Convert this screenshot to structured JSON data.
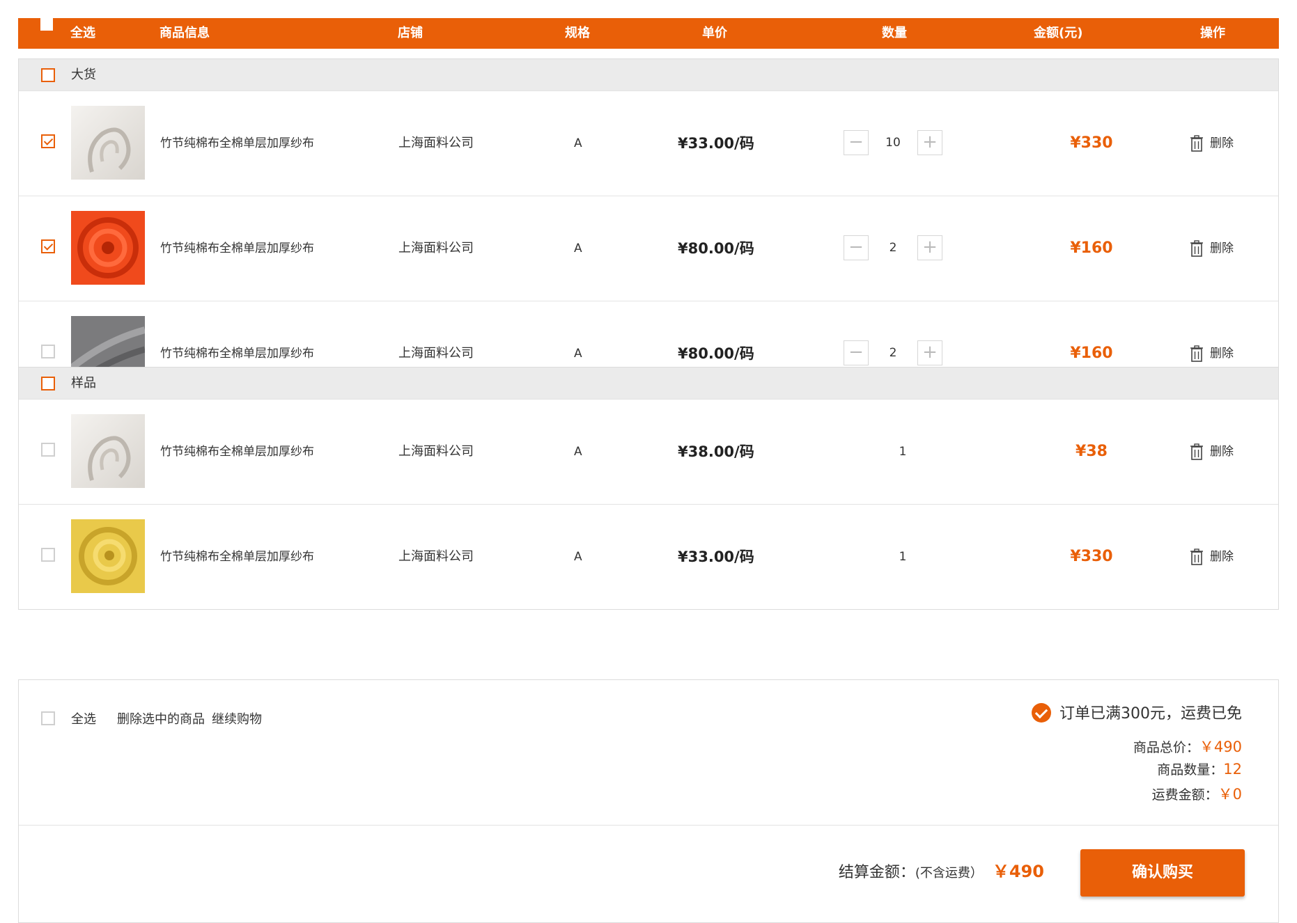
{
  "colors": {
    "accent": "#e95f08",
    "group_header_bg": "#ebebeb"
  },
  "header": {
    "select_all": "全选",
    "product_info": "商品信息",
    "shop": "店铺",
    "spec": "规格",
    "unit_price": "单价",
    "quantity": "数量",
    "amount": "金额(元)",
    "action": "操作"
  },
  "groups": [
    {
      "name": "大货",
      "checked": false,
      "items": [
        {
          "name": "竹节纯棉布全棉单层加厚纱布",
          "shop": "上海面料公司",
          "spec": "A",
          "price": "¥33.00/码",
          "qty": "10",
          "amount": "¥330",
          "delete": "删除",
          "checked": true,
          "image": "white-fabric",
          "stepper": true
        },
        {
          "name": "竹节纯棉布全棉单层加厚纱布",
          "shop": "上海面料公司",
          "spec": "A",
          "price": "¥80.00/码",
          "qty": "2",
          "amount": "¥160",
          "delete": "删除",
          "checked": true,
          "image": "orange-fabric",
          "stepper": true
        },
        {
          "name": "竹节纯棉布全棉单层加厚纱布",
          "shop": "上海面料公司",
          "spec": "A",
          "price": "¥80.00/码",
          "qty": "2",
          "amount": "¥160",
          "delete": "删除",
          "checked": false,
          "image": "gray-fabric",
          "stepper": true
        }
      ]
    },
    {
      "name": "样品",
      "checked": false,
      "items": [
        {
          "name": "竹节纯棉布全棉单层加厚纱布",
          "shop": "上海面料公司",
          "spec": "A",
          "price": "¥38.00/码",
          "qty": "1",
          "amount": "¥38",
          "delete": "删除",
          "checked": false,
          "image": "white-fabric",
          "stepper": false
        },
        {
          "name": "竹节纯棉布全棉单层加厚纱布",
          "shop": "上海面料公司",
          "spec": "A",
          "price": "¥33.00/码",
          "qty": "1",
          "amount": "¥330",
          "delete": "删除",
          "checked": false,
          "image": "yellow-fabric",
          "stepper": false
        }
      ]
    }
  ],
  "footer": {
    "select_all": "全选",
    "delete_selected": "删除选中的商品",
    "continue_shopping": "继续购物",
    "free_shipping_notice": "订单已满300元，运费已免",
    "total_price_label": "商品总价：",
    "total_price_value": "￥490",
    "quantity_label": "商品数量：",
    "quantity_value": "12",
    "shipping_label": "运费金额：",
    "shipping_value": "￥0",
    "settle_label": "结算金额：",
    "settle_note": "(不含运费）",
    "settle_value": "￥490",
    "confirm_button": "确认购买"
  }
}
